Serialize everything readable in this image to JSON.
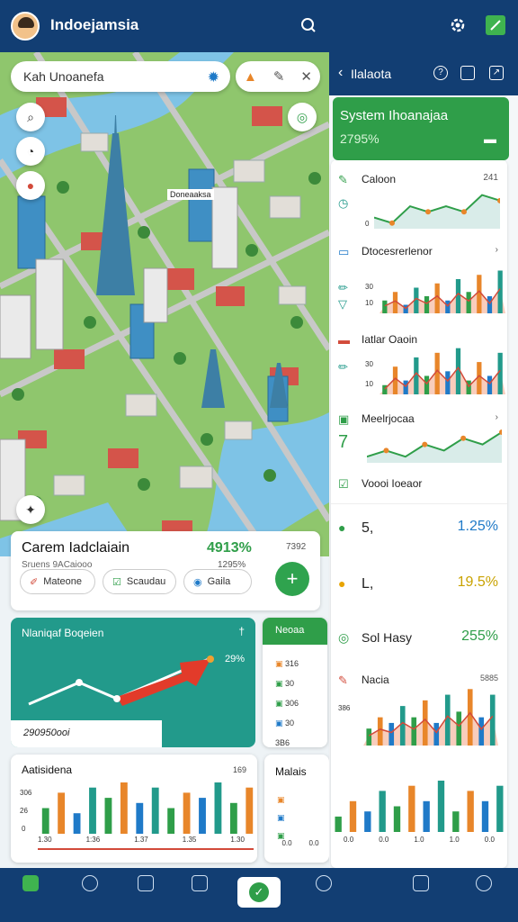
{
  "app": {
    "title": "Indoejamsia"
  },
  "colors": {
    "navy": "#123e73",
    "green": "#2f9e49",
    "teal": "#229a8b",
    "orange": "#e8862a",
    "blue": "#1f7ac8"
  },
  "map": {
    "search_text": "Kah Unoanefa",
    "place_label": "Doneaaksa",
    "icons": [
      "pin-icon",
      "location-icon",
      "car-icon",
      "layers-icon"
    ],
    "tools": [
      "bell-icon",
      "edit-icon",
      "close-icon"
    ]
  },
  "summary_card": {
    "title": "Carem Iadclaiain",
    "subtitle": "Sruens 9ACaiooo",
    "value": "4913%",
    "value_sub": "1295%",
    "right_small": "7392",
    "chips": [
      "Mateone",
      "Scaudau",
      "Gaila"
    ]
  },
  "right_panel": {
    "header": "Ilalaota",
    "system_card": {
      "title": "System Ihoanajaa",
      "value": "2795%"
    },
    "items": [
      {
        "label": "Caloon",
        "right": "241",
        "axis": [
          "0"
        ]
      },
      {
        "label": "Dtocesrerlenor",
        "right": "›",
        "axis": [
          "30",
          "10"
        ]
      },
      {
        "label": "Iatlar Oaoin",
        "right": "",
        "axis": [
          "30",
          "10"
        ]
      },
      {
        "label": "Meelrjocaa",
        "right": "›",
        "axis": [
          "7"
        ]
      },
      {
        "label": "Voooi Ioeaor",
        "right": ""
      }
    ],
    "stats": [
      {
        "label": "5,",
        "value": "1.25%",
        "color": "#1f7ac8"
      },
      {
        "label": "L,",
        "value": "19.5%",
        "color": "#c9a200"
      },
      {
        "label": "Sol Hasy",
        "value": "255%",
        "color": "#2f9e49"
      }
    ],
    "bottom_chart": {
      "title": "Nacia",
      "right": "5885",
      "axis": "386"
    }
  },
  "teal_card": {
    "title": "Nlaniqaf Boqeien",
    "corner": "†",
    "value": "29%",
    "footer": "290950ooi"
  },
  "mini_list": {
    "header": "Neoaa",
    "items": [
      "316",
      "30",
      "306",
      "30",
      "3B6"
    ]
  },
  "bar_card": {
    "title": "Aatisidena",
    "right": "169",
    "y_axis": [
      "306",
      "26",
      "0"
    ],
    "x_axis": [
      "1.30",
      "1:36",
      "1.37",
      "1.35",
      "1.30"
    ]
  },
  "right_bottom_card": {
    "title": "Malais",
    "x_axis": [
      "0.0",
      "0.0",
      "0.0",
      "0.0",
      "1.0",
      "1.0",
      "0.0",
      "0.0"
    ]
  },
  "chart_data": [
    {
      "type": "area",
      "title": "Caloon",
      "values": [
        4,
        3,
        6,
        5,
        6,
        5,
        8,
        7
      ]
    },
    {
      "type": "bar",
      "title": "Dtocesrerlenor",
      "values": [
        3,
        5,
        2,
        6,
        4,
        7,
        3,
        8,
        5,
        9,
        4,
        10
      ]
    },
    {
      "type": "bar",
      "title": "Iatlar Oaoin",
      "values": [
        2,
        6,
        3,
        8,
        4,
        9,
        5,
        10,
        3,
        7,
        4,
        9
      ]
    },
    {
      "type": "line",
      "title": "Meelrjocaa",
      "values": [
        2,
        3,
        2,
        4,
        3,
        5,
        4,
        6
      ]
    },
    {
      "type": "bar",
      "title": "Nacia",
      "values": [
        3,
        5,
        4,
        7,
        5,
        8,
        4,
        9,
        6,
        10,
        5,
        9
      ]
    },
    {
      "type": "bar",
      "title": "Aatisidena",
      "values": [
        5,
        8,
        4,
        9,
        7,
        10,
        6,
        9,
        5,
        8,
        7,
        10,
        6,
        9
      ]
    },
    {
      "type": "bar",
      "title": "Malais",
      "values": [
        3,
        6,
        4,
        8,
        5,
        9,
        6,
        10,
        4,
        8,
        6,
        9
      ]
    }
  ]
}
